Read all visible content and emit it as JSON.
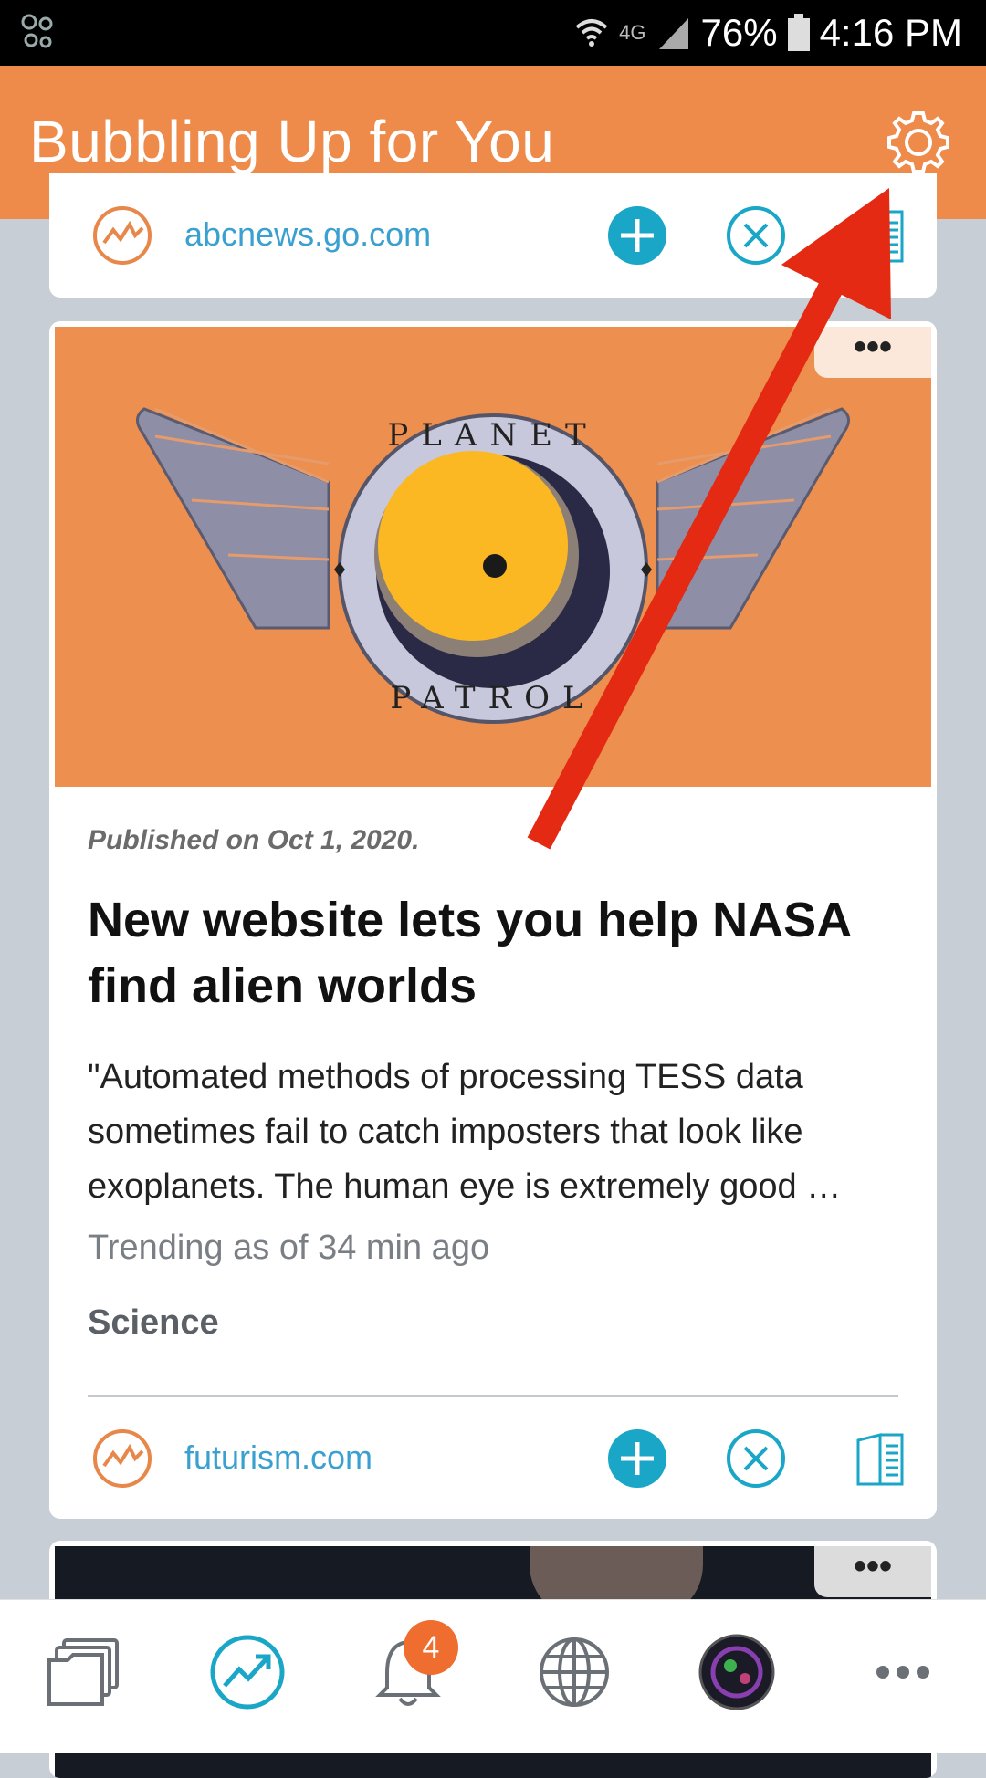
{
  "status_bar": {
    "network": "4G",
    "battery": "76%",
    "time": "4:16 PM"
  },
  "header": {
    "title": "Bubbling Up for You",
    "settings_icon": "gear-icon"
  },
  "cards": [
    {
      "source": "abcnews.go.com",
      "actions": [
        "add-icon",
        "dismiss-icon",
        "read-icon"
      ]
    },
    {
      "image_alt": "Planet Patrol logo",
      "image_text_top": "PLANET",
      "image_text_bottom": "PATROL",
      "more_label": "•••",
      "published": "Published on Oct 1, 2020.",
      "headline": "New website lets you help NASA find alien worlds",
      "excerpt": "\"Automated methods of processing TESS data sometimes fail to catch imposters that look like exoplanets. The human eye is extremely good …",
      "trending": "Trending as of 34 min ago",
      "category": "Science",
      "source": "futurism.com",
      "actions": [
        "add-icon",
        "dismiss-icon",
        "read-icon"
      ]
    },
    {
      "more_label": "•••"
    }
  ],
  "bottom_nav": {
    "items": [
      "folders-icon",
      "trending-icon",
      "bell-icon",
      "globe-icon",
      "avatar",
      "more-icon"
    ],
    "notification_count": "4"
  },
  "colors": {
    "accent_orange": "#ee8a4a",
    "accent_teal": "#1aa6c7",
    "link_blue": "#3aa0cf",
    "annotation_red": "#e42a12"
  }
}
